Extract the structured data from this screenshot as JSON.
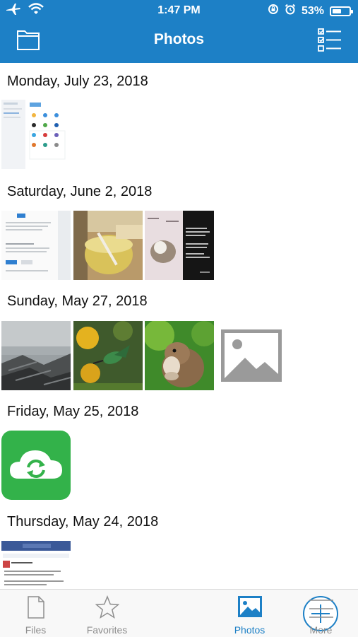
{
  "status_bar": {
    "time": "1:47 PM",
    "battery": "53%",
    "battery_level": 0.53
  },
  "header": {
    "title": "Photos",
    "left_icon": "folder-icon",
    "right_icon": "checklist-icon"
  },
  "sections": [
    {
      "date": "Monday, July 23, 2018"
    },
    {
      "date": "Saturday, June 2, 2018"
    },
    {
      "date": "Sunday, May 27, 2018"
    },
    {
      "date": "Friday, May 25, 2018"
    },
    {
      "date": "Thursday, May 24, 2018"
    }
  ],
  "tabbar": {
    "files": "Files",
    "favorites": "Favorites",
    "photos": "Photos",
    "more": "More"
  },
  "colors": {
    "accent": "#1d80c6",
    "tab_inactive": "#8e8e8e",
    "sync_green": "#33b24a"
  }
}
